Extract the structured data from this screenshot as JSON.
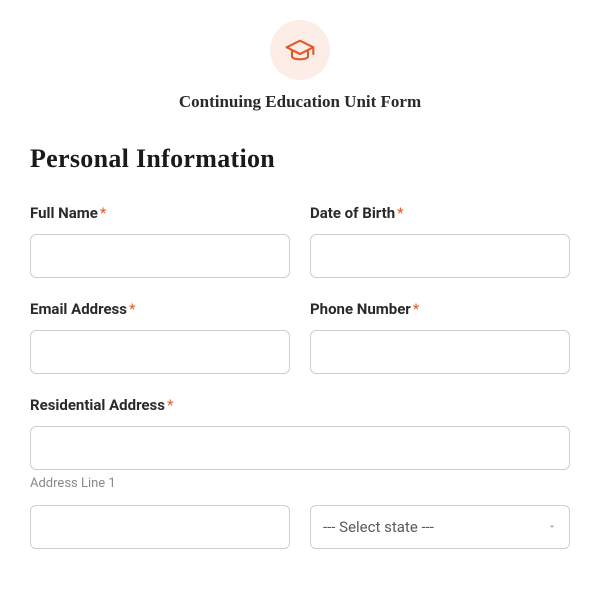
{
  "header": {
    "title": "Continuing Education Unit Form"
  },
  "section": {
    "heading": "Personal Information"
  },
  "fields": {
    "full_name": {
      "label": "Full Name",
      "required": "*"
    },
    "dob": {
      "label": "Date of Birth",
      "required": "*"
    },
    "email": {
      "label": "Email Address",
      "required": "*"
    },
    "phone": {
      "label": "Phone Number",
      "required": "*"
    },
    "address": {
      "label": "Residential Address",
      "required": "*",
      "sub1": "Address Line 1"
    },
    "state": {
      "placeholder": "--- Select state ---"
    }
  }
}
